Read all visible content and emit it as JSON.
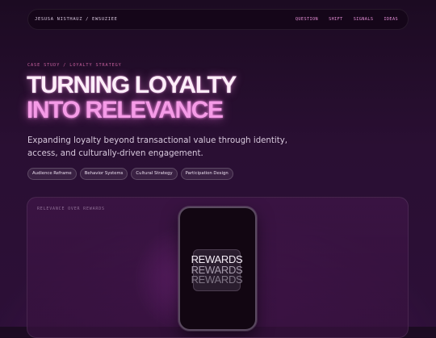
{
  "nav": {
    "brand": "JESUSA NISTHAUZ / EWSUZIEE",
    "links": [
      "QUESTION",
      "SHIFT",
      "SIGNALS",
      "IDEAS"
    ]
  },
  "hero": {
    "eyebrow": "CASE STUDY / LOYALTY STRATEGY",
    "title_line1": "TURNING LOYALTY",
    "title_line2": "INTO RELEVANCE",
    "lede": "Expanding loyalty beyond transactional value through identity, access, and culturally-driven engagement.",
    "tags": [
      "Audience Reframe",
      "Behavior Systems",
      "Cultural Strategy",
      "Participation Design"
    ]
  },
  "panel": {
    "label": "RELEVANCE OVER REWARDS",
    "card_words": [
      "REWARDS",
      "REWARDS",
      "REWARDS"
    ]
  },
  "colors": {
    "accent_pink": "#f59be7",
    "nav_link": "#e78fd9",
    "eyebrow": "#c8609f",
    "background": "#2a0f33"
  }
}
